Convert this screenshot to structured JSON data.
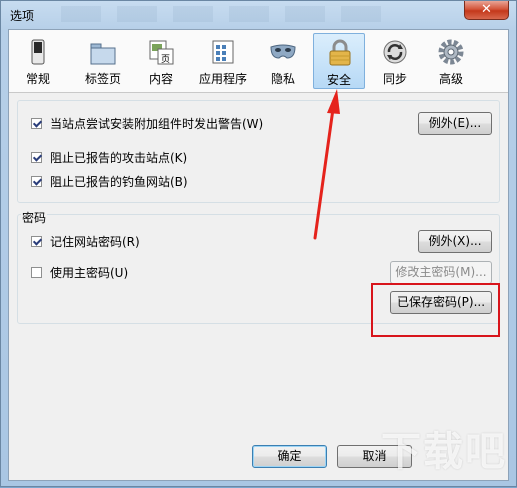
{
  "window": {
    "title": "选项",
    "close_glyph": "✕"
  },
  "tabs": [
    {
      "label": "常规",
      "icon": "switch-icon"
    },
    {
      "label": "标签页",
      "icon": "folder-tabs-icon"
    },
    {
      "label": "内容",
      "icon": "page-content-icon"
    },
    {
      "label": "应用程序",
      "icon": "applications-icon"
    },
    {
      "label": "隐私",
      "icon": "mask-icon"
    },
    {
      "label": "安全",
      "icon": "padlock-icon",
      "selected": true
    },
    {
      "label": "同步",
      "icon": "sync-icon"
    },
    {
      "label": "高级",
      "icon": "gear-icon"
    }
  ],
  "security": {
    "warn_addons": {
      "label": "当站点尝试安装附加组件时发出警告(W)",
      "checked": true
    },
    "exceptions_label": "例外(E)...",
    "block_attack": {
      "label": "阻止已报告的攻击站点(K)",
      "checked": true
    },
    "block_phishing": {
      "label": "阻止已报告的钓鱼网站(B)",
      "checked": true
    }
  },
  "passwords": {
    "group_title": "密码",
    "remember": {
      "label": "记住网站密码(R)",
      "checked": true
    },
    "exceptions_label": "例外(X)...",
    "master": {
      "label": "使用主密码(U)",
      "checked": false
    },
    "change_master_label": "修改主密码(M)...",
    "saved_passwords_label": "已保存密码(P)..."
  },
  "footer": {
    "ok_label": "确定",
    "cancel_label": "取消"
  },
  "watermark": "下载吧",
  "colors": {
    "accent": "#7fb0dd",
    "annotation": "#d8141b"
  }
}
